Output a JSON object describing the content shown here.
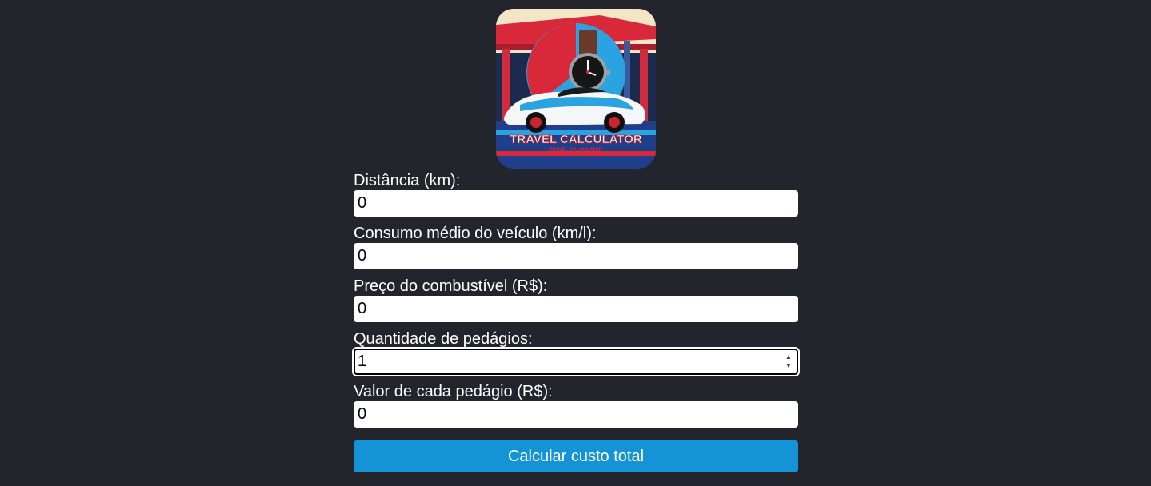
{
  "logo": {
    "title_text": "TRAVEL CALCULATOR",
    "subtitle_text": "TRAVEL CALCULATOR"
  },
  "form": {
    "fields": [
      {
        "label": "Distância (km):",
        "value": "0"
      },
      {
        "label": "Consumo médio do veículo (km/l):",
        "value": "0"
      },
      {
        "label": "Preço do combustível (R$):",
        "value": "0"
      },
      {
        "label": "Quantidade de pedágios:",
        "value": "1"
      },
      {
        "label": "Valor de cada pedágio (R$):",
        "value": "0"
      }
    ],
    "submit_label": "Calcular custo total"
  },
  "colors": {
    "background": "#22262c",
    "button": "#1493d6",
    "input_background": "#ffffff"
  }
}
